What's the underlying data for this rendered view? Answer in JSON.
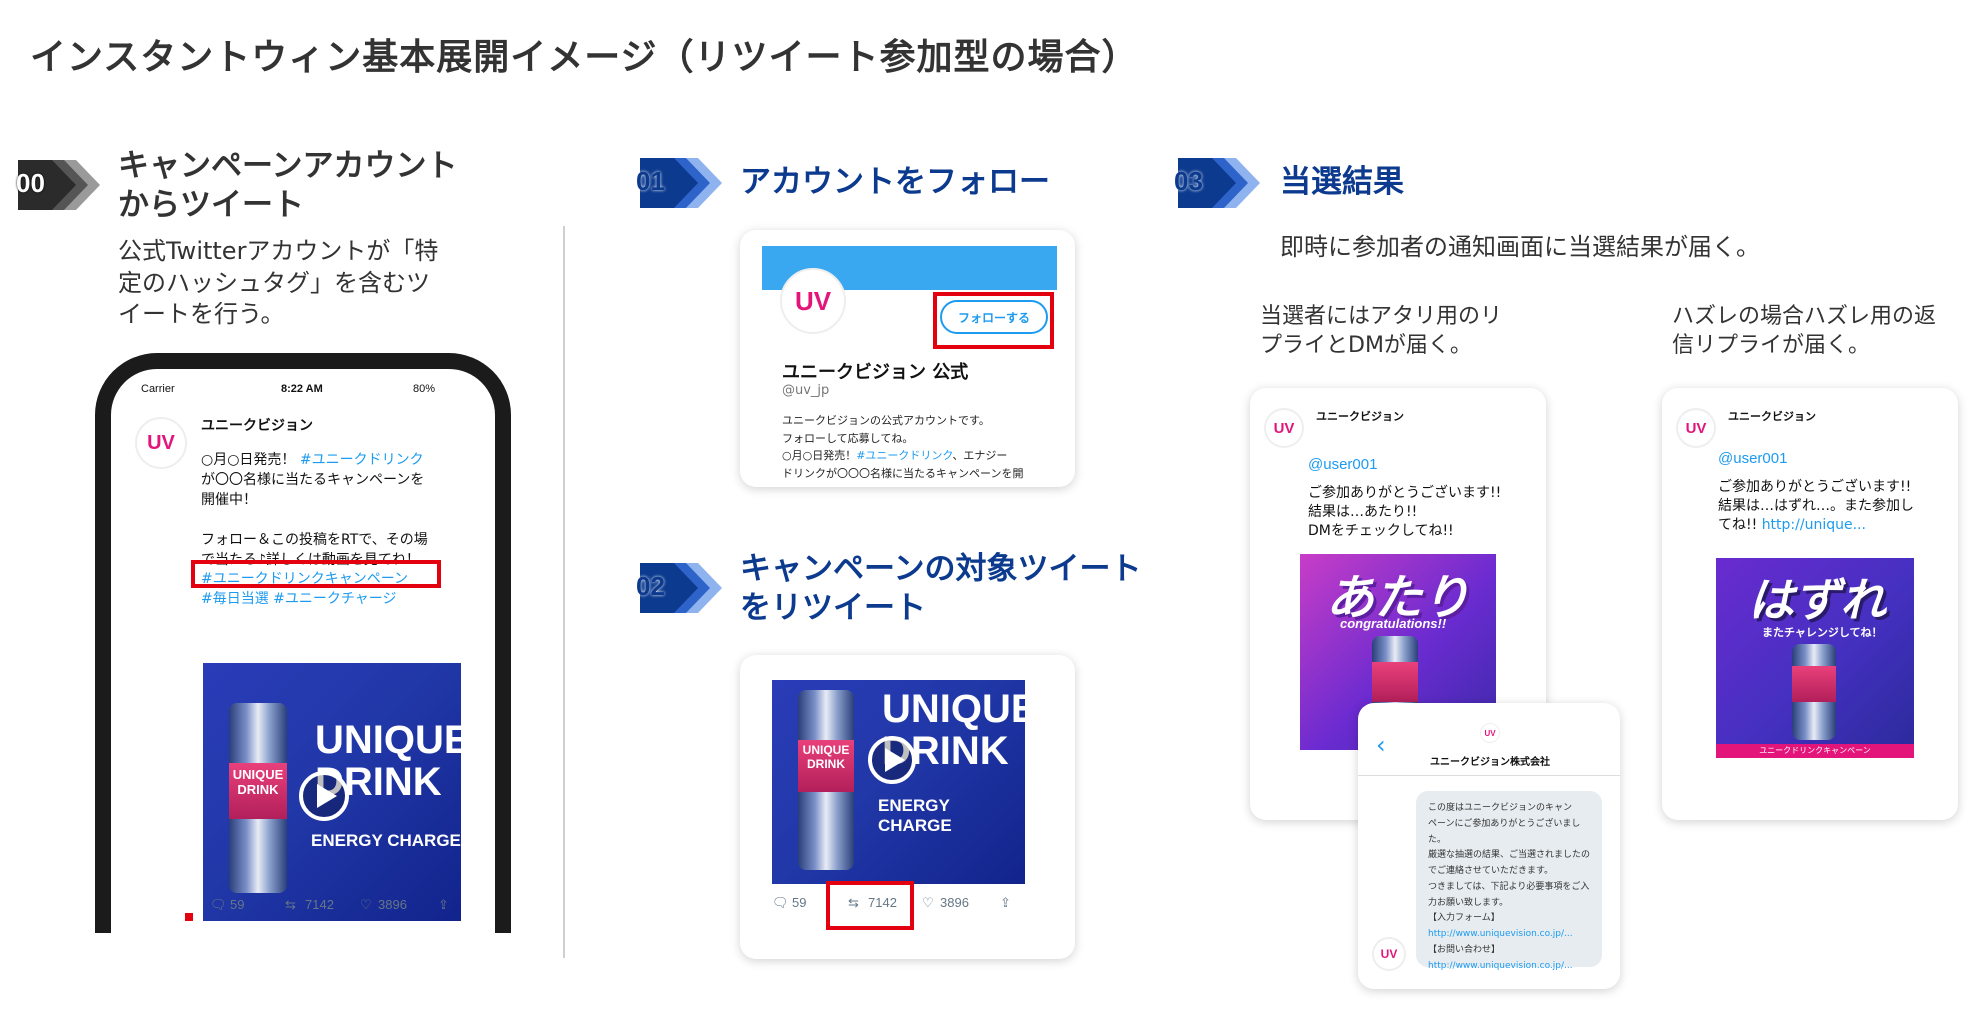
{
  "page_title": "インスタントウィン基本展開イメージ（リツイート参加型の場合）",
  "colors": {
    "step_navy": "#0b3a8f",
    "step_blue": "#1a5cc4",
    "highlight_red": "#e3000f",
    "twitter_blue": "#1d9bf0",
    "brand_pink": "#e4157a"
  },
  "step0": {
    "num": "00",
    "title_line1": "キャンペーンアカウント",
    "title_line2": "からツイート",
    "desc_line1": "公式Twitterアカウントが「特",
    "desc_line2": "定のハッシュタグ」を含むツ",
    "desc_line3": "イートを行う。"
  },
  "phone": {
    "status_carrier": "Carrier",
    "status_time": "8:22 AM",
    "status_battery": "80%",
    "account_name": "ユニークビジョン",
    "avatar_logo": "UV",
    "tweet_line1_a": "○月○日発売！",
    "tweet_line1_b": "#ユニークドリンク",
    "tweet_line2": "が〇〇名様に当たるキャンペーンを",
    "tweet_line3": "開催中！",
    "tweet_line4": "フォロー＆この投稿をRTで、その場",
    "tweet_line5": "で当たる♪詳しくは動画を見てね！",
    "hashtag_main": "#ユニークドリンクキャンペーン",
    "hashtag_sub": "#毎日当選 #ユニークチャージ",
    "image_title_line1": "UNIQUE",
    "image_title_line2": "DRINK",
    "image_energy": "ENERGY  CHARGE",
    "can_line1": "UNIQUE",
    "can_line2": "DRINK",
    "reply_count": "59",
    "retweet_count": "7142",
    "like_count": "3896"
  },
  "step1": {
    "num": "01",
    "title": "アカウントをフォロー",
    "follow_button": "フォローする",
    "account_name": "ユニークビジョン 公式",
    "handle": "@uv_jp",
    "bio_line1": "ユニークビジョンの公式アカウントです。",
    "bio_line2": "フォローして応募してね。",
    "bio_line3_a": "○月○日発売！",
    "bio_line3_b": "#ユニークドリンク",
    "bio_line3_c": "、エナジー",
    "bio_line4": "ドリンクが〇〇〇名様に当たるキャンペーンを開"
  },
  "step2": {
    "num": "02",
    "title_line1": "キャンペーンの対象ツイート",
    "title_line2": "をリツイート",
    "reply_count": "59",
    "retweet_count": "7142",
    "like_count": "3896"
  },
  "step3": {
    "num": "03",
    "title": "当選結果",
    "desc": "即時に参加者の通知画面に当選結果が届く。",
    "win_desc_line1": "当選者にはアタリ用のリ",
    "win_desc_line2": "プライとDMが届く。",
    "lose_desc_line1": "ハズレの場合ハズレ用の返",
    "lose_desc_line2": "信リプライが届く。"
  },
  "win_card": {
    "account_name": "ユニークビジョン",
    "mention": "@user001",
    "line1": "ご参加ありがとうございます!!",
    "line2": "結果は…あたり!!",
    "line3": "DMをチェックしてね!!",
    "big_word": "あたり",
    "sub_word": "congratulations!!"
  },
  "dm_card": {
    "company": "ユニークビジョン株式会社",
    "line1": "この度はユニークビジョンのキャン",
    "line2": "ペーンにご参加ありがとうございました。",
    "line3": "厳選な抽選の結果、ご当選されましたの",
    "line4": "でご連絡させていただきます。",
    "line5": "つきましては、下記より必要事項をご入",
    "line6": "力お願い致します。",
    "line7": "【入力フォーム】",
    "line8": "http://www.uniquevision.co.jp/...",
    "line9": "【お問い合わせ】",
    "line10": "http://www.uniquevision.co.jp/..."
  },
  "lose_card": {
    "account_name": "ユニークビジョン",
    "mention": "@user001",
    "line1": "ご参加ありがとうございます!!",
    "line2": "結果は…はずれ…。また参加し",
    "line3_a": "てね!!",
    "line3_b": "http://unique...",
    "big_word": "はずれ",
    "sub_word": "またチャレンジしてね！",
    "banner": "ユニークドリンクキャンペーン"
  }
}
